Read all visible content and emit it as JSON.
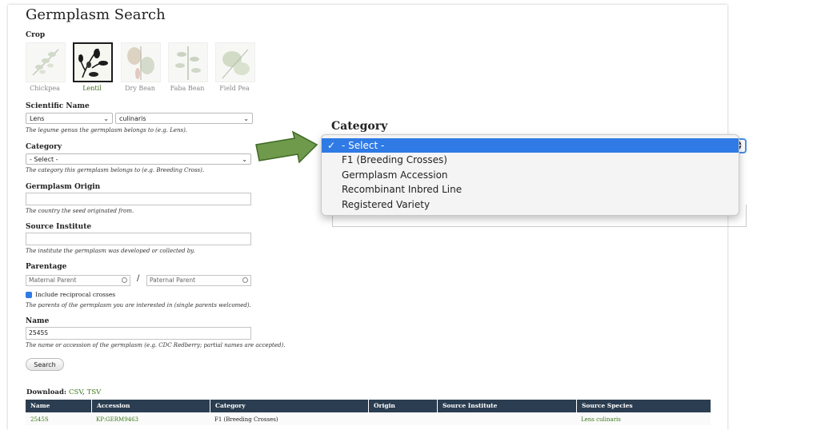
{
  "page": {
    "title": "Germplasm Search"
  },
  "crop": {
    "label": "Crop",
    "options": [
      {
        "name": "Chickpea"
      },
      {
        "name": "Lentil"
      },
      {
        "name": "Dry Bean"
      },
      {
        "name": "Faba Bean"
      },
      {
        "name": "Field Pea"
      }
    ],
    "selected": "Lentil"
  },
  "scientific_name": {
    "label": "Scientific Name",
    "genus": "Lens",
    "species": "culinaris",
    "help": "The legume genus the germplasm belongs to (e.g. Lens)."
  },
  "category": {
    "label": "Category",
    "value": "- Select -",
    "help": "The category this germplasm belongs to (e.g. Breeding Cross)."
  },
  "origin": {
    "label": "Germplasm Origin",
    "value": "",
    "help": "The country the seed originated from."
  },
  "institute": {
    "label": "Source Institute",
    "value": "",
    "help": "The institute the germplasm was developed or collected by."
  },
  "parentage": {
    "label": "Parentage",
    "maternal_placeholder": "Maternal Parent",
    "paternal_placeholder": "Paternal Parent",
    "separator": "/",
    "reciprocal_label": "Include reciprocal crosses",
    "reciprocal_checked": true,
    "help": "The parents of the germplasm you are interested in (single parents welcomed)."
  },
  "name_field": {
    "label": "Name",
    "value": "2545S",
    "help": "The name or accession of the germplasm (e.g. CDC Redberry; partial names are accepted)."
  },
  "search_button": "Search",
  "download": {
    "label": "Download:",
    "csv": "CSV",
    "sep": ",",
    "tsv": "TSV"
  },
  "results": {
    "columns": [
      "Name",
      "Accession",
      "Category",
      "Origin",
      "Source Institute",
      "Source Species"
    ],
    "rows": [
      {
        "name": "2545S",
        "accession": "KP:GERM9463",
        "category": "F1 (Breeding Crosses)",
        "origin": "",
        "institute": "",
        "species": "Lens culinaris"
      }
    ]
  },
  "zoom": {
    "label": "Category",
    "options": [
      "- Select -",
      "F1 (Breeding Crosses)",
      "Germplasm Accession",
      "Recombinant Inbred Line",
      "Registered Variety"
    ],
    "selected_index": 0
  },
  "colors": {
    "accent": "#3d7a1a",
    "header": "#2b3d50",
    "highlight": "#2f7ae5",
    "arrow": "#5e8f3c"
  }
}
